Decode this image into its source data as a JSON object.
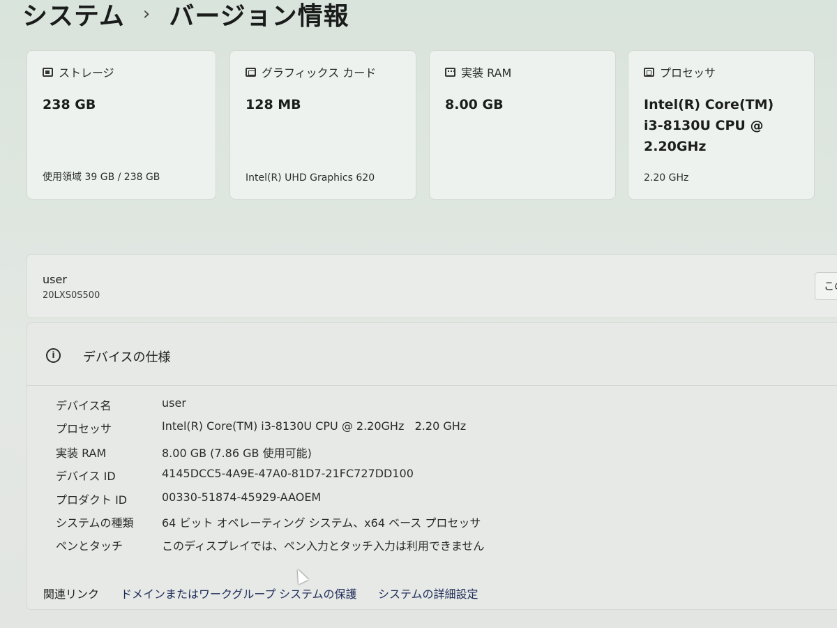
{
  "breadcrumb": {
    "parent": "システム",
    "separator": "›",
    "current": "バージョン情報"
  },
  "cards": [
    {
      "icon": "storage-icon",
      "label": "ストレージ",
      "value": "238 GB",
      "sub": "使用領域 39 GB / 238 GB"
    },
    {
      "icon": "graphics-card-icon",
      "label": "グラフィックス カード",
      "value": "128 MB",
      "sub": "Intel(R) UHD Graphics 620"
    },
    {
      "icon": "ram-icon",
      "label": "実装 RAM",
      "value": "8.00 GB",
      "sub": ""
    },
    {
      "icon": "processor-icon",
      "label": "プロセッサ",
      "value_lines": [
        "Intel(R) Core(TM)",
        "i3-8130U CPU @",
        "2.20GHz"
      ],
      "sub": "2.20 GHz"
    }
  ],
  "device": {
    "name": "user",
    "model": "20LXS0S500",
    "rename_button": "この"
  },
  "spec": {
    "title": "デバイスの仕様",
    "rows": [
      {
        "label": "デバイス名",
        "value": "user"
      },
      {
        "label": "プロセッサ",
        "value": "Intel(R) Core(TM) i3-8130U CPU @ 2.20GHz   2.20 GHz"
      },
      {
        "label": "実装 RAM",
        "value": "8.00 GB (7.86 GB 使用可能)"
      },
      {
        "label": "デバイス ID",
        "value": "4145DCC5-4A9E-47A0-81D7-21FC727DD100"
      },
      {
        "label": "プロダクト ID",
        "value": "00330-51874-45929-AAOEM"
      },
      {
        "label": "システムの種類",
        "value": "64 ビット オペレーティング システム、x64 ベース プロセッサ"
      },
      {
        "label": "ペンとタッチ",
        "value": "このディスプレイでは、ペン入力とタッチ入力は利用できません"
      }
    ]
  },
  "related": {
    "label": "関連リンク",
    "links": [
      "ドメインまたはワークグループ",
      "システムの保護",
      "システムの詳細設定"
    ]
  }
}
